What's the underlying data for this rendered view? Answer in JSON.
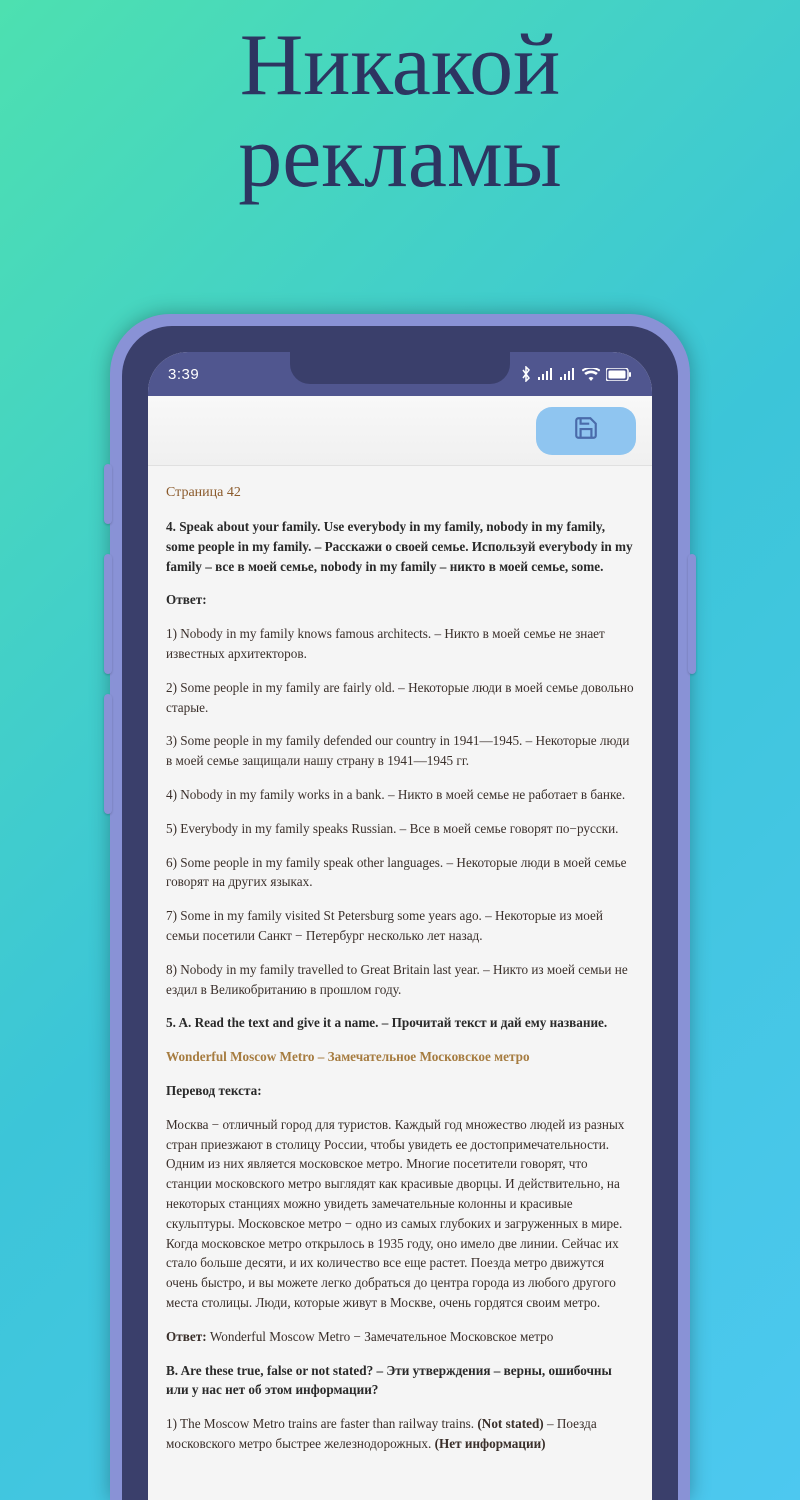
{
  "headline_line1": "Никакой",
  "headline_line2": "рекламы",
  "status": {
    "time": "3:39"
  },
  "content": {
    "page_label": "Страница 42",
    "task4": "4. Speak about your family. Use everybody in my family, nobody in my family, some people in my family. – Расскажи о своей семье. Используй everybody in my family – все в моей семье, nobody in my family – никто в моей семье, some.",
    "answer_label": "Ответ:",
    "a1": "1) Nobody in my family knows famous architects. – Никто в моей семье не знает известных архитекторов.",
    "a2": "2) Some people in my family are fairly old. – Некоторые люди в моей семье довольно старые.",
    "a3": "3) Some people in my family defended our country in 1941—1945. – Некоторые люди в моей семье защищали нашу страну в 1941—1945 гг.",
    "a4": "4) Nobody in my family works in a bank. – Никто в моей семье не работает в банке.",
    "a5": "5) Everybody in my family speaks Russian. – Все в моей семье говорят по−русски.",
    "a6": "6) Some people in my family speak other languages. – Некоторые люди в моей семье говорят на других языках.",
    "a7": "7) Some in my family visited St Petersburg some years ago. – Некоторые из моей семьи посетили Санкт − Петербург несколько лет назад.",
    "a8": "8) Nobody in my family travelled to Great Britain last year. – Никто из моей семьи не ездил в Великобританию в прошлом году.",
    "task5": "5. A. Read the text and give it a name. – Прочитай текст и дай ему название.",
    "metro_title": "Wonderful Moscow Metro – Замечательное Московское метро",
    "translation_label": "Перевод текста:",
    "metro_p1": "Москва − отличный город для туристов. Каждый год множество людей из разных стран приезжают в столицу России, чтобы увидеть ее достопримечательности. Одним из них является московское метро. Многие посетители говорят, что станции московского метро выглядят как красивые дворцы. И действительно, на некоторых станциях можно увидеть замечательные колонны и красивые скульптуры. Московское метро − одно из самых глубоких и загруженных в мире.",
    "metro_p2": "Когда московское метро открылось в 1935 году, оно имело две линии. Сейчас их стало больше десяти, и их количество все еще растет. Поезда метро движутся очень быстро, и вы можете легко добраться до центра города из любого другого места столицы. Люди, которые живут в Москве, очень гордятся своим метро.",
    "answer2_prefix": "Ответ: ",
    "answer2_text": "Wonderful Moscow Metro − Замечательное Московское метро",
    "taskB": "B. Are these true, false or not stated? – Эти утверждения – верны, ошибочны или у нас нет об этом информации?",
    "b1_text": "1) The Moscow Metro trains are faster than railway trains. ",
    "b1_ns": "(Not stated)",
    "b1_tail": " – Поезда московского метро быстрее железнодорожных. ",
    "b1_ni": "(Нет информации)"
  }
}
